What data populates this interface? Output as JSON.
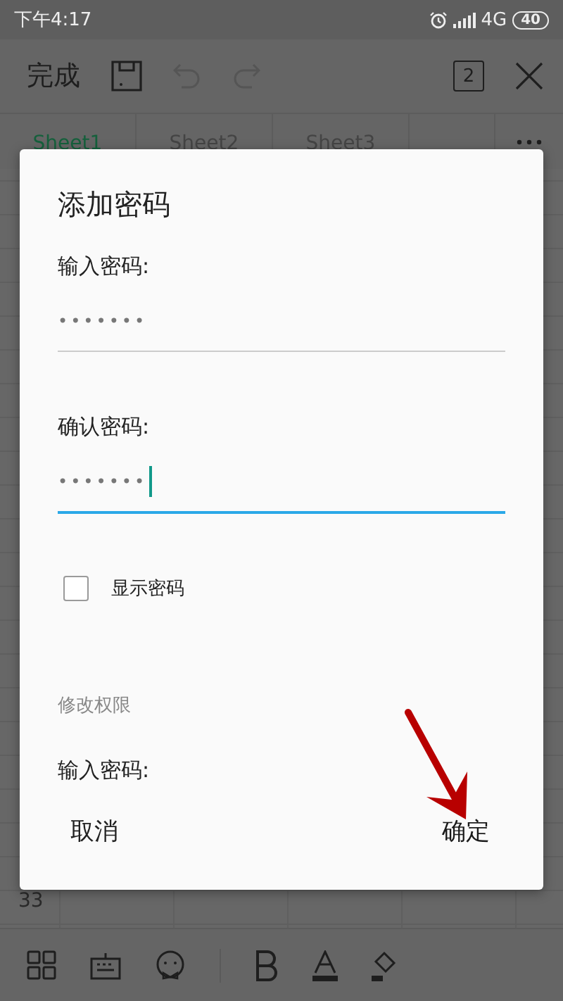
{
  "status_bar": {
    "time": "下午4:17",
    "network": "4G",
    "battery": "40"
  },
  "toolbar": {
    "done": "完成",
    "page_count": "2"
  },
  "sheet_tabs": [
    {
      "label": "Sheet1",
      "selected": true
    },
    {
      "label": "Sheet2",
      "selected": false
    },
    {
      "label": "Sheet3",
      "selected": false
    }
  ],
  "spreadsheet": {
    "row_label": "33"
  },
  "dialog": {
    "title": "添加密码",
    "fields": [
      {
        "label": "输入密码:",
        "value": "•••••••",
        "focused": false
      },
      {
        "label": "确认密码:",
        "value": "•••••••",
        "focused": true
      }
    ],
    "show_password": {
      "label": "显示密码",
      "checked": false
    },
    "section": "修改权限",
    "cut_label": "输入密码:",
    "buttons": [
      {
        "label": "取消",
        "kind": "cancel"
      },
      {
        "label": "确定",
        "kind": "ok"
      }
    ]
  }
}
